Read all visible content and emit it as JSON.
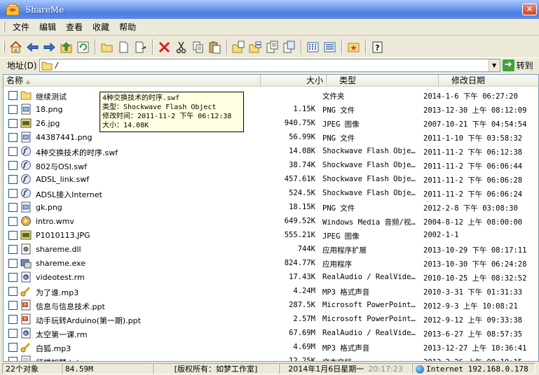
{
  "window": {
    "title": "ShareMe"
  },
  "menu": {
    "items": [
      "文件",
      "编辑",
      "查看",
      "收藏",
      "帮助"
    ]
  },
  "address": {
    "label": "地址(D)",
    "value": "/",
    "go_label": "转到"
  },
  "columns": {
    "name": "名称",
    "size": "大小",
    "type": "类型",
    "date": "修改日期"
  },
  "files": [
    {
      "name": "继续测试",
      "size": "",
      "type": "文件夹",
      "date": "2014-1-6 下午 06:27:20",
      "icon": "folder-icon"
    },
    {
      "name": "18.png",
      "size": "1.15K",
      "type": "PNG 文件",
      "date": "2013-12-30 上午 08:12:09",
      "icon": "image-file-icon"
    },
    {
      "name": "26.jpg",
      "size": "940.75K",
      "type": "JPEG 图像",
      "date": "2007-10-21 下午 04:54:54",
      "icon": "jpeg-file-icon"
    },
    {
      "name": "44387441.png",
      "size": "56.99K",
      "type": "PNG 文件",
      "date": "2011-1-10 下午 03:58:32",
      "icon": "image-file-icon"
    },
    {
      "name": "4种交换技术的时序.swf",
      "size": "14.08K",
      "type": "Shockwave Flash Obje…",
      "date": "2011-11-2 下午 06:12:38",
      "icon": "flash-file-icon"
    },
    {
      "name": "802与OSI.swf",
      "size": "38.74K",
      "type": "Shockwave Flash Obje…",
      "date": "2011-11-2 下午 06:06:44",
      "icon": "flash-file-icon"
    },
    {
      "name": "ADSL_link.swf",
      "size": "457.61K",
      "type": "Shockwave Flash Obje…",
      "date": "2011-11-2 下午 06:06:28",
      "icon": "flash-file-icon"
    },
    {
      "name": "ADSL接入Internet",
      "size": "524.5K",
      "type": "Shockwave Flash Obje…",
      "date": "2011-11-2 下午 06:06:24",
      "icon": "flash-file-icon"
    },
    {
      "name": "gk.png",
      "size": "18.15K",
      "type": "PNG 文件",
      "date": "2012-2-8 下午 03:08:30",
      "icon": "image-file-icon"
    },
    {
      "name": "intro.wmv",
      "size": "649.52K",
      "type": "Windows Media 音频/视…",
      "date": "2004-8-12 上午 08:00:00",
      "icon": "media-file-icon"
    },
    {
      "name": "P1010113.JPG",
      "size": "555.21K",
      "type": "JPEG 图像",
      "date": "2002-1-1",
      "icon": "jpeg-file-icon"
    },
    {
      "name": "shareme.dll",
      "size": "744K",
      "type": "应用程序扩展",
      "date": "2013-10-29 下午 08:17:11",
      "icon": "dll-file-icon"
    },
    {
      "name": "shareme.exe",
      "size": "824.77K",
      "type": "应用程序",
      "date": "2013-10-30 下午 06:24:28",
      "icon": "exe-file-icon"
    },
    {
      "name": "videotest.rm",
      "size": "17.43K",
      "type": "RealAudio / RealVide…",
      "date": "2010-10-25 上午 08:32:52",
      "icon": "realmedia-file-icon"
    },
    {
      "name": "为了谁.mp3",
      "size": "4.24M",
      "type": "MP3 格式声音",
      "date": "2010-3-31 下午 01:31:33",
      "icon": "mp3-file-icon"
    },
    {
      "name": "信息与信息技术.ppt",
      "size": "287.5K",
      "type": "Microsoft PowerPoint…",
      "date": "2012-9-3 上午 10:08:21",
      "icon": "ppt-file-icon"
    },
    {
      "name": "动手玩转Arduino(第一期).ppt",
      "size": "2.57M",
      "type": "Microsoft PowerPoint…",
      "date": "2012-9-12 上午 09:33:38",
      "icon": "ppt-file-icon"
    },
    {
      "name": "太空第一课.rm",
      "size": "67.69M",
      "type": "RealAudio / RealVide…",
      "date": "2013-6-27 上午 08:57:35",
      "icon": "realmedia-file-icon"
    },
    {
      "name": "白狐.mp3",
      "size": "4.69M",
      "type": "MP3 格式声音",
      "date": "2013-12-27 上午 10:36:41",
      "icon": "mp3-file-icon"
    },
    {
      "name": "红楼如梦.txt",
      "size": "12.25K",
      "type": "文本文档",
      "date": "2013-2-26 上午 08:10:15",
      "icon": "text-file-icon"
    }
  ],
  "tooltip": {
    "line1": "4种交换技术的时序.swf",
    "line2": "类型：Shockwave Flash Object",
    "line3": "修改时间：2011-11-2 下午 06:12:38",
    "line4": "大小：14.08K"
  },
  "status": {
    "count": "22个对象",
    "total_size": "84.59M",
    "copyright": "[版权所有：如梦工作室]",
    "date": "2014年1月6日星期一",
    "time": "20:17:23",
    "network": "Internet 192.168.0.178"
  }
}
